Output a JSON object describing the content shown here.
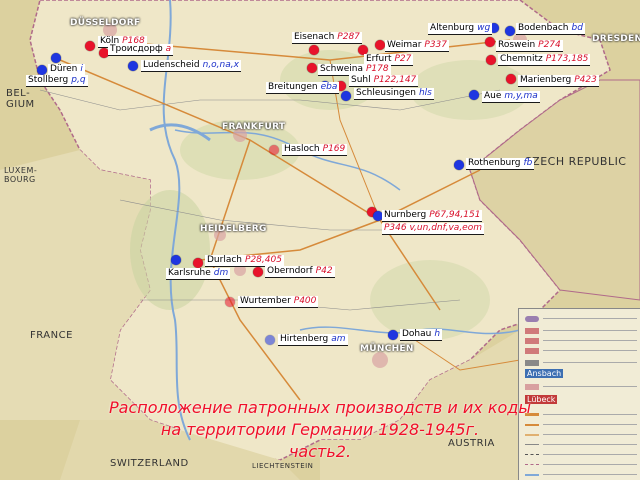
{
  "countries": [
    {
      "key": "belgium",
      "text": "BEL-\nGIUM"
    },
    {
      "key": "luxembourg",
      "text": "LUXEM-\nBOURG"
    },
    {
      "key": "france",
      "text": "FRANCE"
    },
    {
      "key": "czech",
      "text": "CZECH REPUBLIC"
    },
    {
      "key": "switzerland",
      "text": "SWITZERLAND"
    },
    {
      "key": "austria",
      "text": "AUSTRIA"
    },
    {
      "key": "liechtenstein",
      "text": "LIECHTENSTEIN"
    }
  ],
  "base_cities": [
    "DÜSSELDORF",
    "FRANKFURT",
    "HEIDELBERG",
    "MÜNCHEN",
    "DRESDEN"
  ],
  "sites": [
    {
      "name": "Köln",
      "code": "P168",
      "color": "red"
    },
    {
      "name": "Троисдорф",
      "code": "a",
      "color": "red"
    },
    {
      "name": "Düren",
      "code": "i",
      "color": "blue"
    },
    {
      "name": "Stollberg",
      "code": "p,q",
      "color": "blue"
    },
    {
      "name": "Ludenscheid",
      "code": "n,o,na,x",
      "color": "blue"
    },
    {
      "name": "Eisenach",
      "code": "P287",
      "color": "red"
    },
    {
      "name": "Weimar",
      "code": "P337",
      "color": "red"
    },
    {
      "name": "Erfurt",
      "code": "P27",
      "color": "red"
    },
    {
      "name": "Schweina",
      "code": "P178",
      "color": "red"
    },
    {
      "name": "Suhl",
      "code": "P122,147",
      "color": "red"
    },
    {
      "name": "Breitungen",
      "code": "eba",
      "color": "blue"
    },
    {
      "name": "Schleusingen",
      "code": "hls",
      "color": "blue"
    },
    {
      "name": "Altenburg",
      "code": "wg",
      "color": "blue"
    },
    {
      "name": "Bodenbach",
      "code": "bd",
      "color": "blue"
    },
    {
      "name": "Roswein",
      "code": "P274",
      "color": "red"
    },
    {
      "name": "Chemnitz",
      "code": "P173,185",
      "color": "red"
    },
    {
      "name": "Marienberg",
      "code": "P423",
      "color": "red"
    },
    {
      "name": "Aue",
      "code": "m,y,ma",
      "color": "blue"
    },
    {
      "name": "Hasloch",
      "code": "P169",
      "color": "red"
    },
    {
      "name": "Rothenburg",
      "code": "fb",
      "color": "blue"
    },
    {
      "name": "Nurnberg",
      "code": "P67,94,151",
      "color": "red"
    },
    {
      "name": "",
      "code": "P346 v,un,dnf,va,eom",
      "color": "red"
    },
    {
      "name": "Durlach",
      "code": "P28,405",
      "color": "red"
    },
    {
      "name": "Karlsruhe",
      "code": "dm",
      "color": "blue"
    },
    {
      "name": "Oberndorf",
      "code": "P42",
      "color": "red"
    },
    {
      "name": "Wurtember",
      "code": "P400",
      "color": "red"
    },
    {
      "name": "Hirtenberg",
      "code": "am",
      "color": "blue"
    },
    {
      "name": "Dohau",
      "code": "h",
      "color": "blue"
    }
  ],
  "caption": {
    "line1": "Расположение патронных производств и их коды",
    "line2": "на территории Германии 1928-1945г.",
    "line3": "часть2."
  },
  "legend": {
    "badge1": "Ansbach",
    "badge2": "Lübeck"
  },
  "colors": {
    "red": "#e8132b",
    "blue": "#1f36e0",
    "caption": "#f0102a",
    "land": "#e9e0b8",
    "germany": "#efe7c8"
  }
}
